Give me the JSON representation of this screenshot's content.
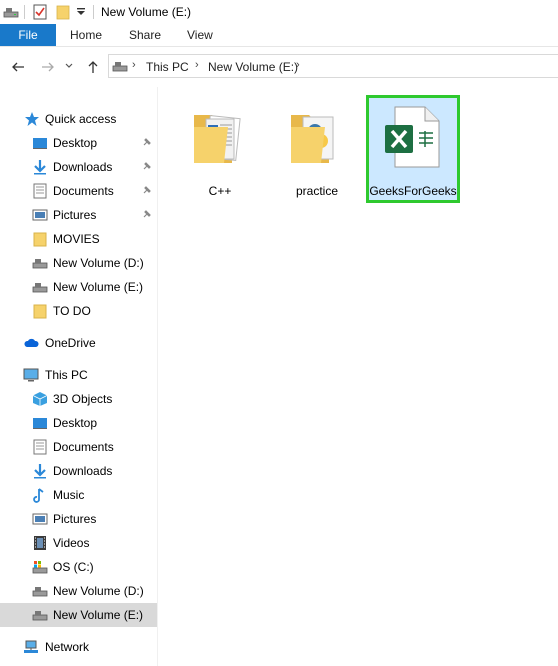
{
  "window": {
    "title": "New Volume (E:)"
  },
  "ribbon": {
    "tabs": [
      "File",
      "Home",
      "Share",
      "View"
    ]
  },
  "address": {
    "segments": [
      "This PC",
      "New Volume (E:)"
    ]
  },
  "sidebar": {
    "quick_access": {
      "label": "Quick access",
      "items": [
        {
          "label": "Desktop",
          "icon": "desktop-icon",
          "pinned": true
        },
        {
          "label": "Downloads",
          "icon": "download-icon",
          "pinned": true
        },
        {
          "label": "Documents",
          "icon": "documents-icon",
          "pinned": true
        },
        {
          "label": "Pictures",
          "icon": "pictures-icon",
          "pinned": true
        },
        {
          "label": "MOVIES",
          "icon": "folder-icon",
          "pinned": false
        },
        {
          "label": "New Volume (D:)",
          "icon": "drive-icon",
          "pinned": false
        },
        {
          "label": "New Volume (E:)",
          "icon": "drive-icon",
          "pinned": false
        },
        {
          "label": "TO DO",
          "icon": "folder-icon",
          "pinned": false
        }
      ]
    },
    "onedrive": {
      "label": "OneDrive"
    },
    "this_pc": {
      "label": "This PC",
      "items": [
        {
          "label": "3D Objects",
          "icon": "cube-icon"
        },
        {
          "label": "Desktop",
          "icon": "desktop-icon"
        },
        {
          "label": "Documents",
          "icon": "documents-icon"
        },
        {
          "label": "Downloads",
          "icon": "download-icon"
        },
        {
          "label": "Music",
          "icon": "music-icon"
        },
        {
          "label": "Pictures",
          "icon": "pictures-icon"
        },
        {
          "label": "Videos",
          "icon": "videos-icon"
        },
        {
          "label": "OS (C:)",
          "icon": "os-drive-icon"
        },
        {
          "label": "New Volume (D:)",
          "icon": "drive-icon"
        },
        {
          "label": "New Volume (E:)",
          "icon": "drive-icon",
          "selected": true
        }
      ]
    },
    "network": {
      "label": "Network"
    }
  },
  "content": {
    "items": [
      {
        "label": "C++",
        "type": "folder"
      },
      {
        "label": "practice",
        "type": "folder"
      },
      {
        "label": "GeeksForGeeks",
        "type": "excel",
        "selected": true
      }
    ]
  },
  "colors": {
    "file_tab": "#1979ca",
    "selection": "#cce8ff",
    "highlight": "#2ec92e",
    "excel_green": "#1d6f42"
  }
}
